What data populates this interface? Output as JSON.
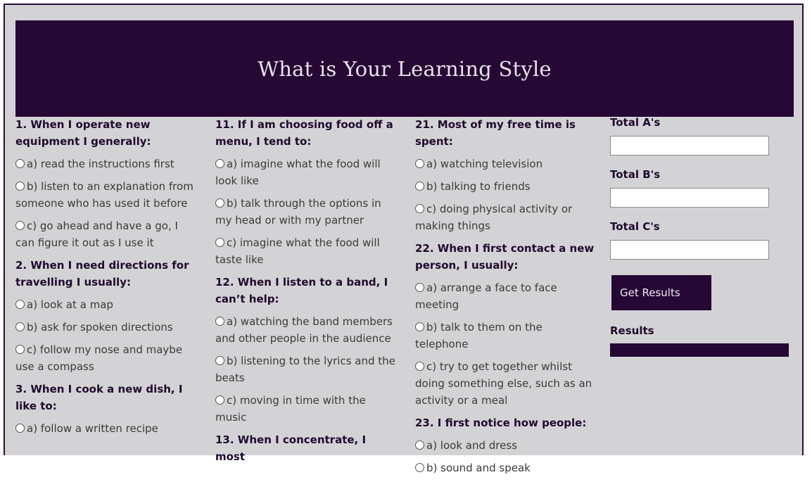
{
  "page": {
    "title": "What is Your Learning Style"
  },
  "columns": [
    {
      "questions": [
        {
          "text": "1. When I operate new equipment I generally:",
          "options": [
            "a) read the instructions first",
            "b) listen to an explanation from someone who has used it before",
            "c) go ahead and have a go, I can figure it out as I use it"
          ]
        },
        {
          "text": "2. When I need directions for travelling I usually:",
          "options": [
            "a) look at a map",
            "b) ask for spoken directions",
            "c) follow my nose and maybe use a compass"
          ]
        },
        {
          "text": "3. When I cook a new dish, I like to:",
          "options": [
            "a) follow a written recipe"
          ]
        }
      ]
    },
    {
      "questions": [
        {
          "text": "11. If I am choosing food off a menu, I tend to:",
          "options": [
            "a) imagine what the food will look like",
            "b) talk through the options in my head or with my partner",
            "c) imagine what the food will taste like"
          ]
        },
        {
          "text": "12. When I listen to a band, I can’t help:",
          "options": [
            "a) watching the band members and other people in the audience",
            "b) listening to the lyrics and the beats",
            "c) moving in time with the music"
          ]
        },
        {
          "text": "13. When I concentrate, I most",
          "options": []
        }
      ]
    },
    {
      "questions": [
        {
          "text": "21. Most of my free time is spent:",
          "options": [
            "a) watching television",
            "b) talking to friends",
            "c) doing physical activity or making things"
          ]
        },
        {
          "text": "22. When I first contact a new person, I usually:",
          "options": [
            "a) arrange a face to face meeting",
            "b) talk to them on the telephone",
            "c) try to get together whilst doing something else, such as an activity or a meal"
          ]
        },
        {
          "text": "23. I first notice how people:",
          "options": [
            "a) look and dress",
            "b) sound and speak"
          ]
        }
      ]
    }
  ],
  "totals": {
    "a_label": "Total A's",
    "b_label": "Total B's",
    "c_label": "Total C's",
    "a_value": "",
    "b_value": "",
    "c_value": ""
  },
  "button": {
    "label": "Get Results"
  },
  "results": {
    "label": "Results"
  },
  "colors": {
    "accent": "#250834",
    "background": "#d3d3d5"
  }
}
